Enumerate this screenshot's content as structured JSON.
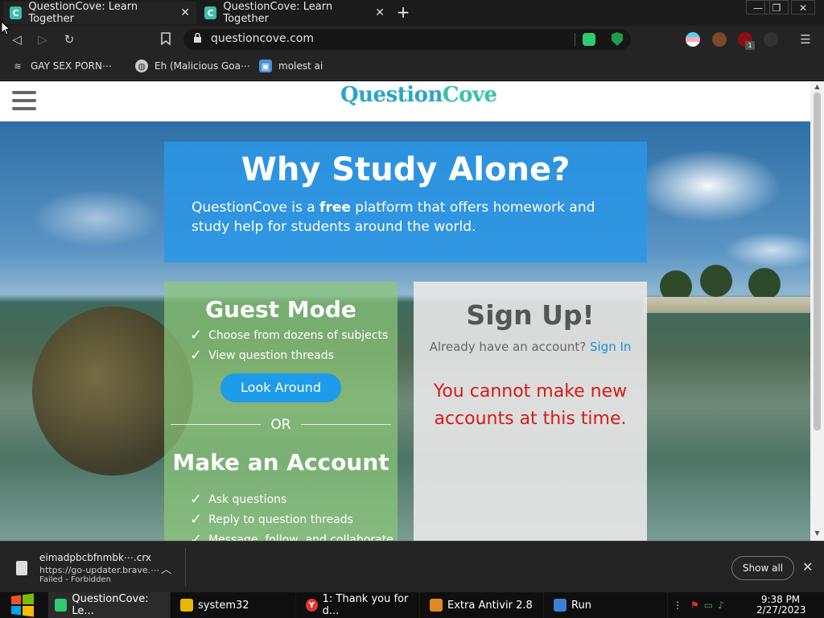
{
  "browser": {
    "tabs": [
      {
        "title": "QuestionCove: Learn Together",
        "favicon": "C"
      },
      {
        "title": "QuestionCove: Learn Together",
        "favicon": "C"
      }
    ],
    "new_tab": "+",
    "window_buttons": [
      "—",
      "❐",
      "✕"
    ],
    "url": "questioncove.com",
    "bookmarks": [
      {
        "label": "GAY SEX PORN⋯",
        "icon": "stack-icon"
      },
      {
        "label": "Eh (Malicious Goa⋯",
        "icon": "globe-icon"
      },
      {
        "label": "molest ai",
        "icon": "image-icon"
      }
    ],
    "extension_badge": "1"
  },
  "site": {
    "logo_part1": "Question",
    "logo_part2": "Cove",
    "hero": {
      "title": "Why Study Alone?",
      "text_before": "QuestionCove is a ",
      "text_bold": "free",
      "text_after": " platform that offers homework and study help for students around the world."
    },
    "guest": {
      "title": "Guest Mode",
      "items": [
        "Choose from dozens of subjects",
        "View question threads"
      ],
      "button": "Look Around",
      "or": "OR",
      "make_title": "Make an Account",
      "make_items": [
        "Ask questions",
        "Reply to question threads",
        "Message, follow, and collaborate"
      ]
    },
    "signup": {
      "title": "Sign Up!",
      "prompt": "Already have an account?",
      "signin_link": "Sign In",
      "error": "You cannot make new accounts at this time."
    }
  },
  "download": {
    "filename": "eimadpbcbfnmbk⋯.crx",
    "url": "https://go-updater.brave.⋯",
    "status": "Failed - Forbidden",
    "show_all": "Show all"
  },
  "taskbar": {
    "items": [
      {
        "label": "QuestionCove: Le...",
        "icon_color": "#2ecc71"
      },
      {
        "label": "system32",
        "icon_color": "#e6b800"
      },
      {
        "label": "1: Thank you for d...",
        "icon_color": "#e03a2f"
      },
      {
        "label": "Extra Antivir 2.8",
        "icon_color": "#e08a1f"
      },
      {
        "label": "Run",
        "icon_color": "#3c7fd6"
      }
    ],
    "time": "9:38 PM",
    "date": "2/27/2023"
  },
  "colors": {
    "accent_teal": "#3dbfa8",
    "hero_blue": "#2b96e6",
    "button_blue": "#1e9be9",
    "error_red": "#d71a1a"
  }
}
